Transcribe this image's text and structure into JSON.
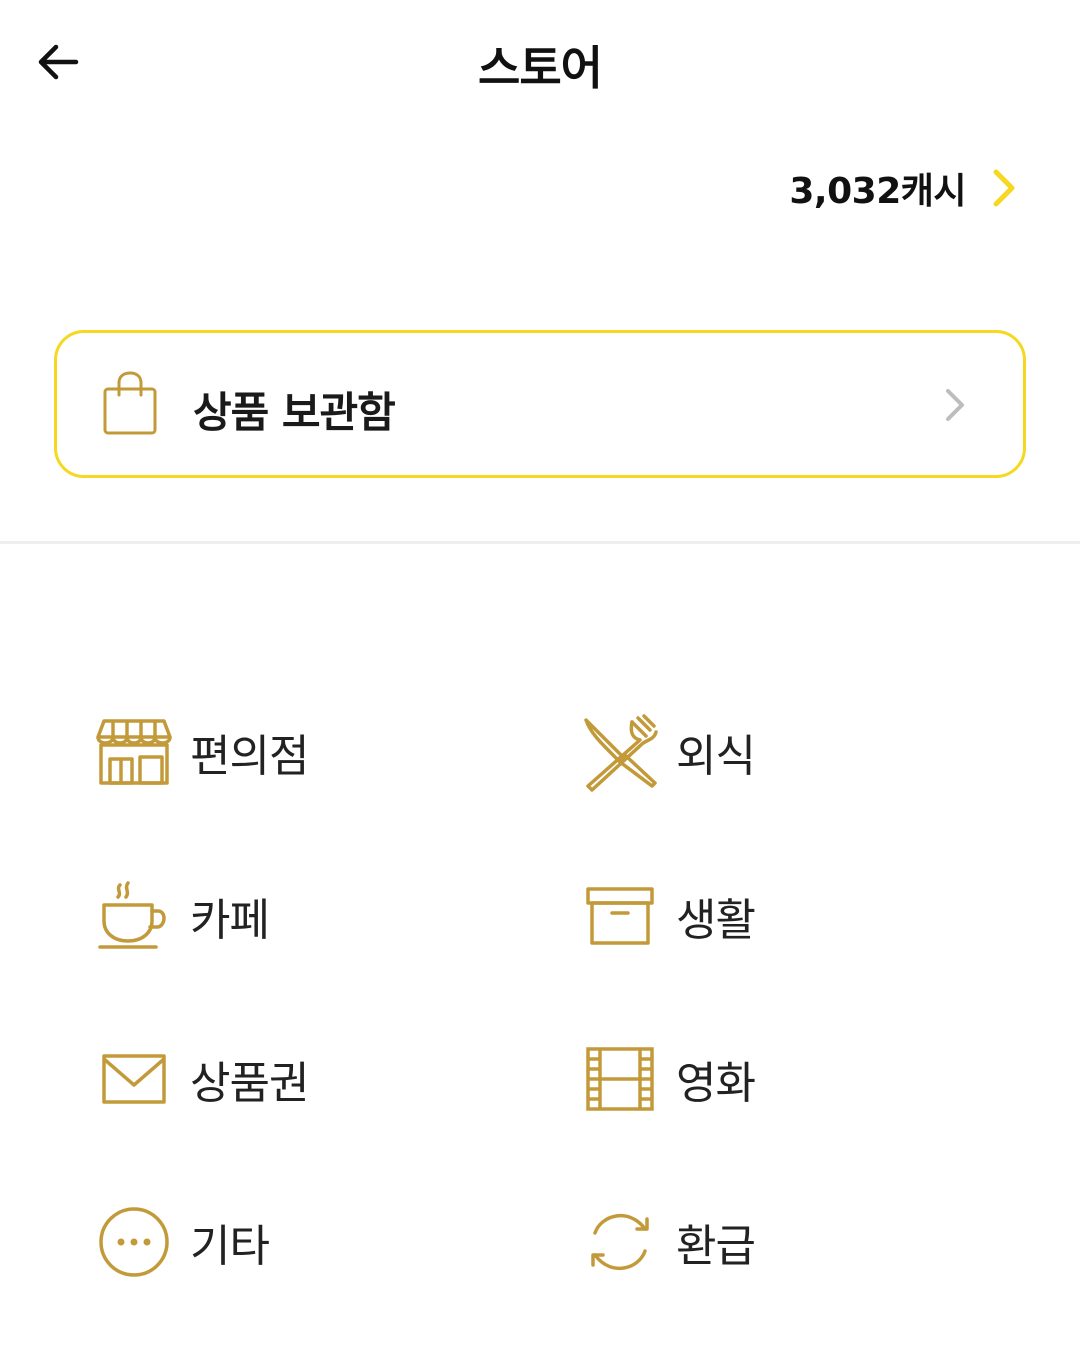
{
  "header": {
    "title": "스토어",
    "back_icon": "arrow-left-icon"
  },
  "cash": {
    "amount": "3,032캐시",
    "chevron_icon": "chevron-right-icon",
    "accent_color": "#f5d81f"
  },
  "storage": {
    "label": "상품 보관함",
    "icon": "shopping-bag-icon",
    "border_color": "#f5d81f"
  },
  "categories": [
    {
      "label": "편의점",
      "icon": "store-icon"
    },
    {
      "label": "외식",
      "icon": "fork-knife-icon"
    },
    {
      "label": "카페",
      "icon": "coffee-cup-icon"
    },
    {
      "label": "생활",
      "icon": "box-icon"
    },
    {
      "label": "상품권",
      "icon": "envelope-icon"
    },
    {
      "label": "영화",
      "icon": "film-icon"
    },
    {
      "label": "기타",
      "icon": "more-icon"
    },
    {
      "label": "환급",
      "icon": "refresh-icon"
    }
  ],
  "icon_color": "#c39a3a"
}
